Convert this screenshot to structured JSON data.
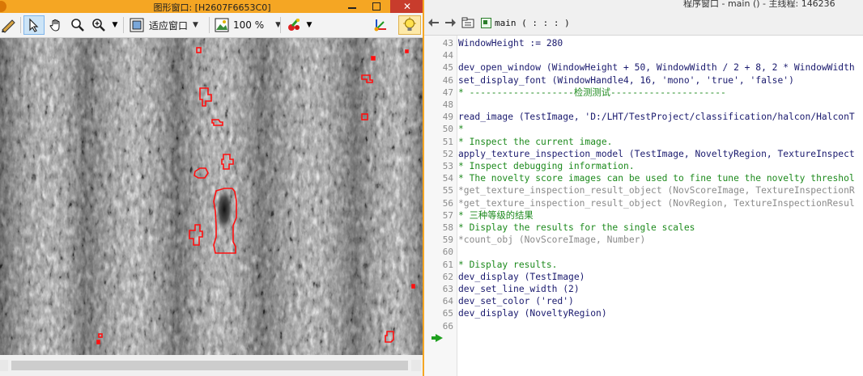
{
  "graphics_window": {
    "title": "图形窗口: [H2607F6653C0]",
    "close_label": "✕",
    "fit_window_label": "适应窗口",
    "zoom_label": "100 %"
  },
  "program_window": {
    "title": "程序窗口 - main () - 主线程: 146236",
    "procedure_selector": "main ( : : : )",
    "lines": [
      {
        "num": "43",
        "text": "WindowHeight := 280",
        "kind": "code"
      },
      {
        "num": "44",
        "text": "",
        "kind": "code"
      },
      {
        "num": "45",
        "text": "dev_open_window (WindowHeight + 50, WindowWidth / 2 + 8, 2 * WindowWidth",
        "kind": "code"
      },
      {
        "num": "46",
        "text": "set_display_font (WindowHandle4, 16, 'mono', 'true', 'false')",
        "kind": "code"
      },
      {
        "num": "47",
        "text": "* -------------------检测测试---------------------",
        "kind": "comment"
      },
      {
        "num": "48",
        "text": "",
        "kind": "code"
      },
      {
        "num": "49",
        "text": "read_image (TestImage, 'D:/LHT/TestProject/classification/halcon/HalconT",
        "kind": "code"
      },
      {
        "num": "50",
        "text": "*",
        "kind": "comment"
      },
      {
        "num": "51",
        "text": "* Inspect the current image.",
        "kind": "comment"
      },
      {
        "num": "52",
        "text": "apply_texture_inspection_model (TestImage, NoveltyRegion, TextureInspect",
        "kind": "code"
      },
      {
        "num": "53",
        "text": "* Inspect debugging information.",
        "kind": "comment"
      },
      {
        "num": "54",
        "text": "* The novelty score images can be used to fine tune the novelty threshol",
        "kind": "comment"
      },
      {
        "num": "55",
        "text": "*get_texture_inspection_result_object (NovScoreImage, TextureInspectionR",
        "kind": "disabled"
      },
      {
        "num": "56",
        "text": "*get_texture_inspection_result_object (NovRegion, TextureInspectionResul",
        "kind": "disabled"
      },
      {
        "num": "57",
        "text": "* 三种等级的结果",
        "kind": "comment"
      },
      {
        "num": "58",
        "text": "* Display the results for the single scales",
        "kind": "comment"
      },
      {
        "num": "59",
        "text": "*count_obj (NovScoreImage, Number)",
        "kind": "disabled"
      },
      {
        "num": "60",
        "text": "",
        "kind": "code"
      },
      {
        "num": "61",
        "text": "* Display results.",
        "kind": "comment"
      },
      {
        "num": "62",
        "text": "dev_display (TestImage)",
        "kind": "code"
      },
      {
        "num": "63",
        "text": "dev_set_line_width (2)",
        "kind": "code"
      },
      {
        "num": "64",
        "text": "dev_set_color ('red')",
        "kind": "code"
      },
      {
        "num": "65",
        "text": "dev_display (NoveltyRegion)",
        "kind": "code"
      },
      {
        "num": "66",
        "text": "",
        "kind": "code"
      }
    ]
  },
  "colors": {
    "graphics_title_bar": "#f5a623",
    "region_outline": "#ff1010",
    "code_text": "#1a1a6e",
    "comment_text": "#1d8a1d",
    "disabled_text": "#8a8a8a"
  }
}
